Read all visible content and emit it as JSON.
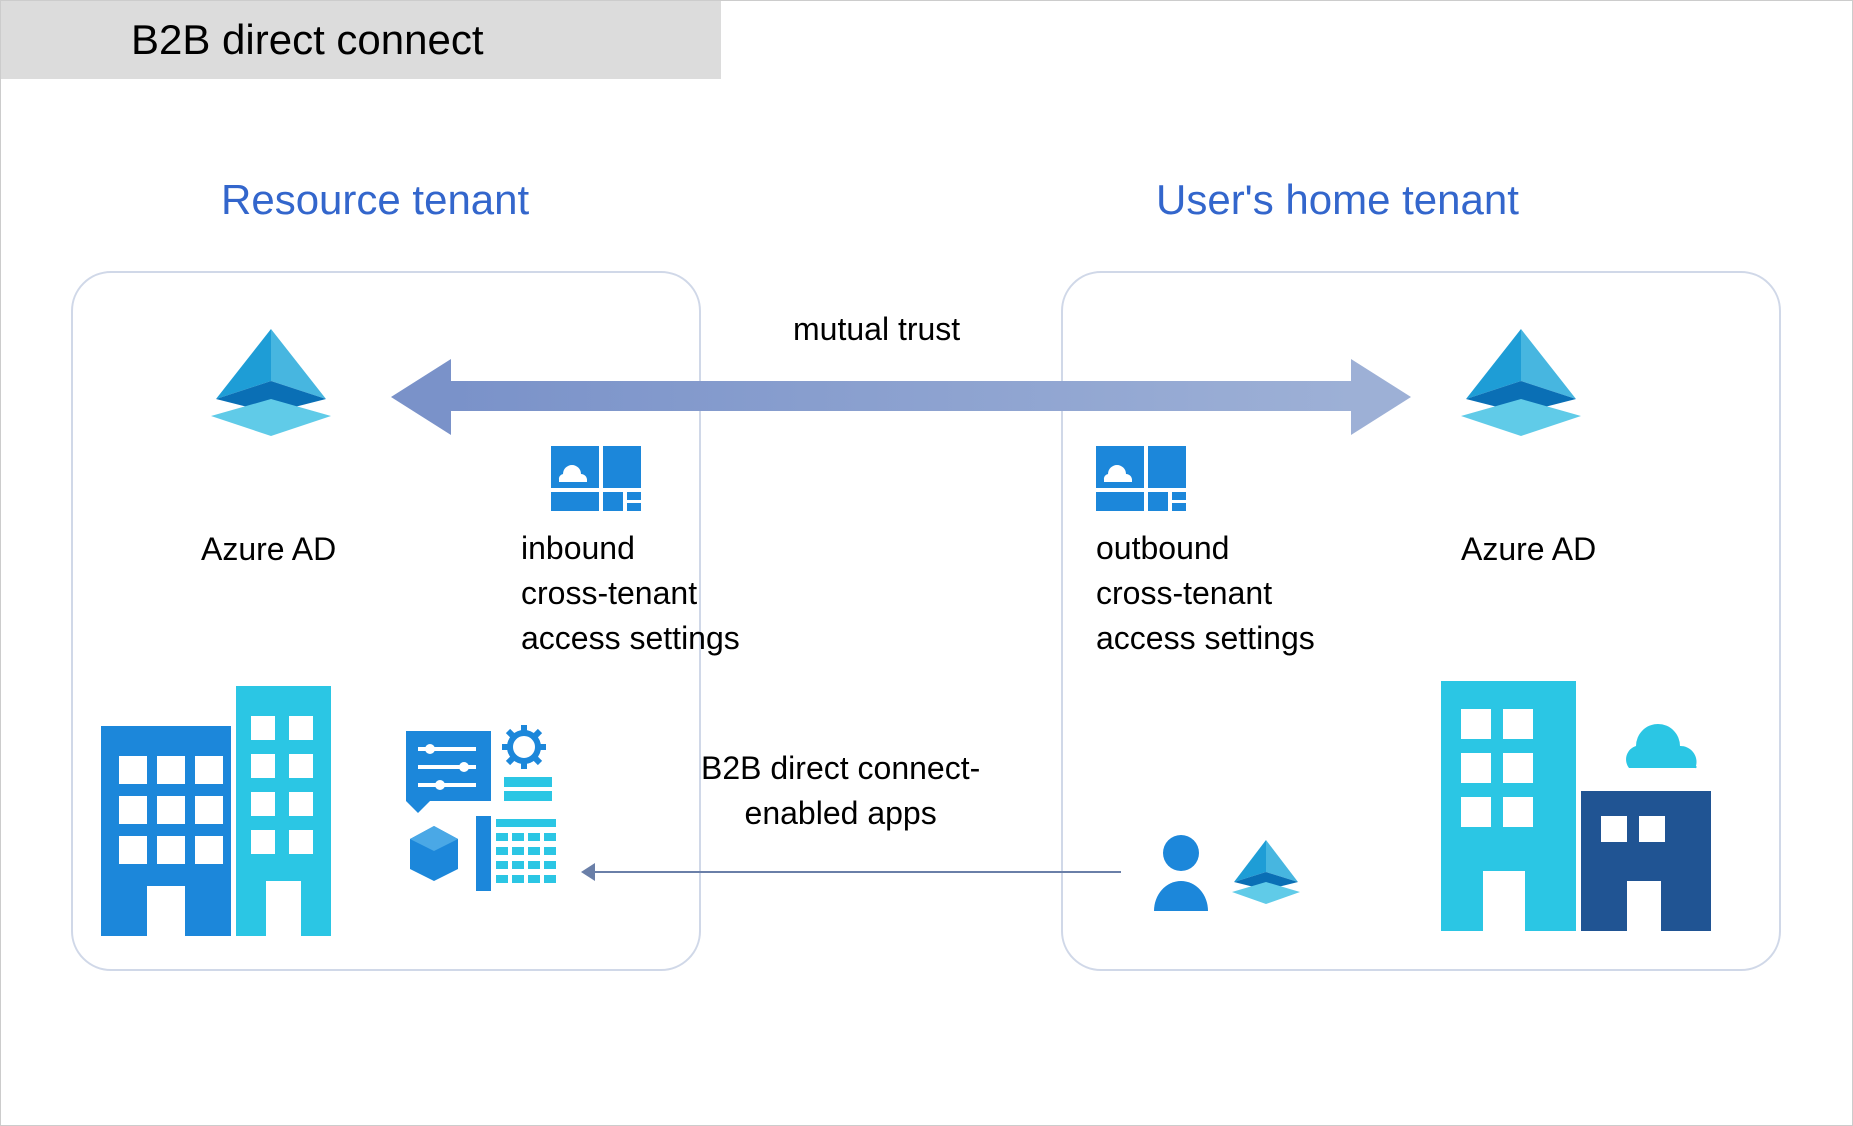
{
  "title": "B2B direct connect",
  "left_tenant": {
    "label": "Resource tenant",
    "azure_label": "Azure AD",
    "settings_line1": "inbound",
    "settings_line2": "cross-tenant",
    "settings_line3": "access settings"
  },
  "right_tenant": {
    "label": "User's home tenant",
    "azure_label": "Azure AD",
    "settings_line1": "outbound",
    "settings_line2": "cross-tenant",
    "settings_line3": "access settings"
  },
  "arrow_label": "mutual trust",
  "apps_label_line1": "B2B direct connect-",
  "apps_label_line2": "enabled apps",
  "colors": {
    "banner_bg": "#dcdcdc",
    "tenant_label": "#3366cc",
    "box_border": "#d0d8e8",
    "arrow_gradient_start": "#7a92c9",
    "arrow_gradient_end": "#9db0d6",
    "icon_blue": "#1c87da",
    "icon_cyan": "#2bc6e4",
    "icon_navy": "#205493",
    "building_dark": "#1c87da",
    "building_light": "#2bc6e4"
  },
  "icons": {
    "azure_ad": "azure-ad-pyramid-icon",
    "settings": "cross-tenant-settings-icon",
    "buildings_org1": "org-buildings-icon",
    "buildings_org2": "org-buildings-cloud-icon",
    "apps": "apps-configuration-icon",
    "user": "user-person-icon"
  }
}
